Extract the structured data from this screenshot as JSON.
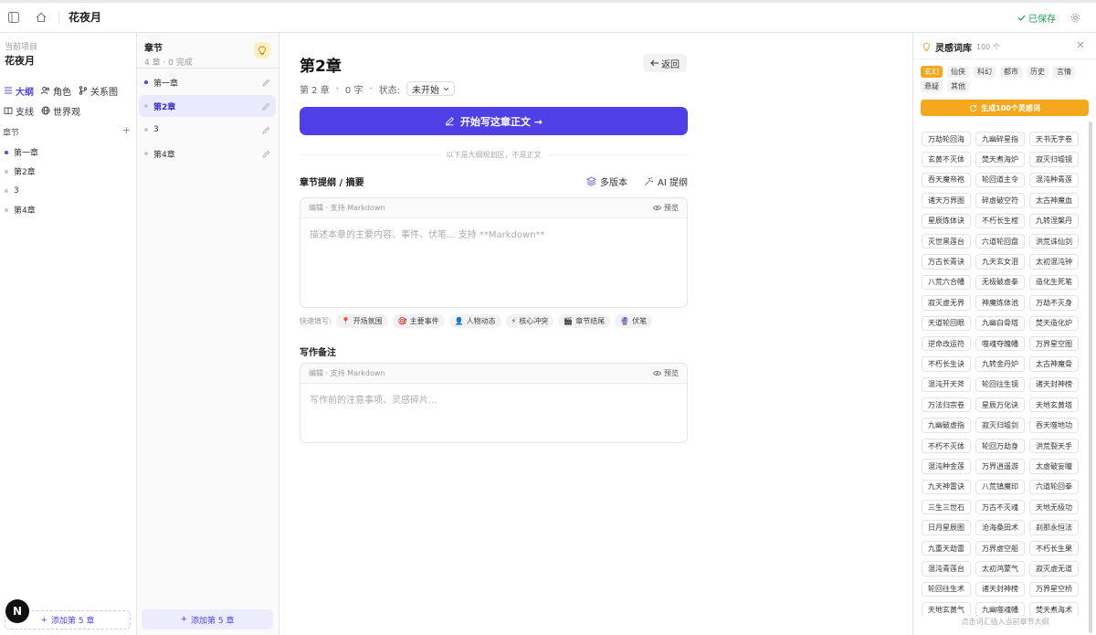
{
  "header": {
    "project_title": "花夜月",
    "saved_label": "已保存"
  },
  "sidebar": {
    "project_label": "当前项目",
    "project_name": "花夜月",
    "nav": [
      {
        "label": "大纲",
        "active": true
      },
      {
        "label": "角色"
      },
      {
        "label": "关系图"
      },
      {
        "label": "支线"
      },
      {
        "label": "世界观"
      }
    ],
    "chapters_heading": "章节",
    "add_symbol": "+",
    "chapters": [
      "第一章",
      "第2章",
      "3",
      "第4章"
    ],
    "add_chapter": "添加第 5 章",
    "avatar_letter": "N"
  },
  "chapter_panel": {
    "title": "章节",
    "subtitle": "4 章 · 0 完成",
    "items": [
      "第一章",
      "第2章",
      "3",
      "第4章"
    ],
    "active_index": 1,
    "add_chapter": "添加第 5 章"
  },
  "main": {
    "title": "第2章",
    "back_label": "返回",
    "meta_chapter": "第 2 章",
    "meta_words": "0 字",
    "meta_sep": "·",
    "status_label": "状态:",
    "status_value": "未开始",
    "start_button": "开始写这章正文 →",
    "hint": "以下是大纲规划区，不是正文",
    "outline_title": "章节提纲 / 摘要",
    "multi_version": "多版本",
    "ai_outline": "AI 提纲",
    "editor_label": "编辑 · 支持 Markdown",
    "preview_label": "预览",
    "outline_placeholder": "描述本章的主要内容、事件、伏笔... 支持 **Markdown**",
    "quick_label": "快速填写:",
    "quick_chips": [
      {
        "emoji": "📍",
        "label": "开场氛围"
      },
      {
        "emoji": "🎯",
        "label": "主要事件"
      },
      {
        "emoji": "👤",
        "label": "人物动态"
      },
      {
        "emoji": "⚡",
        "label": "核心冲突"
      },
      {
        "emoji": "🎬",
        "label": "章节结尾"
      },
      {
        "emoji": "🔮",
        "label": "伏笔"
      }
    ],
    "notes_title": "写作备注",
    "notes_placeholder": "写作前的注意事项、灵感碎片..."
  },
  "inspiration": {
    "title": "灵感词库",
    "count": "100 个",
    "categories": [
      "玄幻",
      "仙侠",
      "科幻",
      "都市",
      "历史",
      "言情",
      "悬疑",
      "其他"
    ],
    "active_category": 0,
    "generate_button": "生成100个灵感词",
    "words": [
      "万劫轮回海",
      "九幽碎星指",
      "天书无字卷",
      "玄黄不灭体",
      "焚天煮海炉",
      "寂灭归墟镜",
      "吞天魔帝袍",
      "轮回道主令",
      "混沌种青莲",
      "诸天万界图",
      "碎虚破空符",
      "太古神魔血",
      "星辰炼体诀",
      "不朽长生棺",
      "九转涅槃丹",
      "灭世黑莲台",
      "六道轮回盘",
      "洪荒诛仙剑",
      "万古长青诀",
      "九天玄女泪",
      "太初混沌钟",
      "八荒六合幡",
      "无极破虚拳",
      "造化生死笔",
      "寂灭虚无界",
      "神魔炼体池",
      "万劫不灭身",
      "天道轮回眼",
      "九幽白骨塔",
      "焚天造化炉",
      "逆命改运符",
      "噬魂夺魄幡",
      "万界星空图",
      "不朽长生诀",
      "九转金丹炉",
      "太古神魔骨",
      "混沌开天斧",
      "轮回往生镜",
      "诸天封神榜",
      "万法归宗卷",
      "星辰万化诀",
      "天地玄黄塔",
      "九幽破虚指",
      "寂灭归墟剑",
      "吞天噬地功",
      "不朽不灭体",
      "轮回万劫身",
      "洪荒裂天手",
      "混沌种金莲",
      "万界逍遥游",
      "太虚破妄瞳",
      "九天神雷诀",
      "八荒镇魔印",
      "六道轮回拳",
      "三生三世石",
      "万古不灭魂",
      "天地无极功",
      "日月星辰图",
      "沧海桑田术",
      "刹那永恒法",
      "九重天劫雷",
      "万界虚空船",
      "不朽长生果",
      "混沌青莲台",
      "太初鸿蒙气",
      "寂灭虚无道",
      "轮回往生术",
      "诸天封神榜",
      "万界星空桥",
      "天地玄黄气",
      "九幽噬魂幡",
      "焚天煮海术"
    ],
    "footer": "点击词汇插入当前章节大纲"
  }
}
